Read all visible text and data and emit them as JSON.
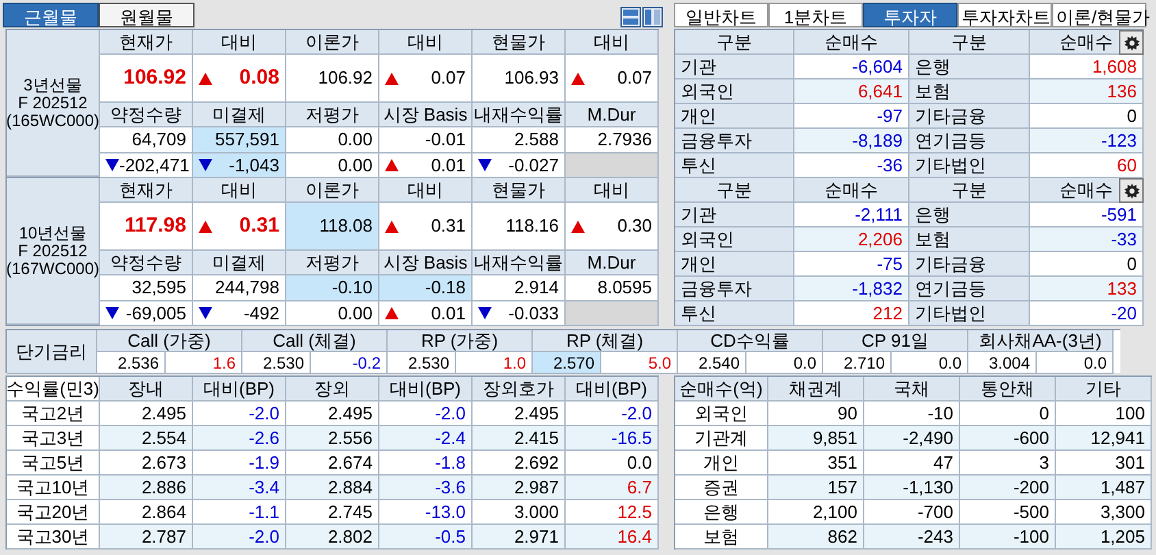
{
  "top_tabs": [
    {
      "label": "근월물",
      "selected": true
    },
    {
      "label": "원월물",
      "selected": false
    }
  ],
  "futures": [
    {
      "label": [
        "3년선물",
        "F 202512",
        "(165WC000)"
      ],
      "head1": [
        "현재가",
        "대비",
        "이론가",
        "대비",
        "현물가",
        "대비"
      ],
      "row1": [
        {
          "text": "106.92",
          "color": "#e00000",
          "highlighted": false
        },
        {
          "text": "0.08",
          "color": "#e00000",
          "kind": "up",
          "highlighted": false
        },
        {
          "text": "106.92",
          "color": "#000000",
          "highlighted": false
        },
        {
          "text": "0.07",
          "color": "#000000",
          "kind": "up",
          "highlighted": false
        },
        {
          "text": "106.93",
          "color": "#000000",
          "highlighted": false
        },
        {
          "text": "0.07",
          "color": "#000000",
          "kind": "up",
          "highlighted": false
        }
      ],
      "head2": [
        "약정수량",
        "미결제",
        "저평가",
        "시장 Basis",
        "내재수익률",
        "M.Dur"
      ],
      "row2": [
        {
          "text": "64,709",
          "color": "#000000",
          "highlighted": false
        },
        {
          "text": "557,591",
          "color": "#000000",
          "highlighted": true
        },
        {
          "text": "0.00",
          "color": "#000000",
          "highlighted": false
        },
        {
          "text": "-0.01",
          "color": "#000000",
          "highlighted": false
        },
        {
          "text": "2.588",
          "color": "#000000",
          "highlighted": false
        },
        {
          "text": "2.7936",
          "color": "#000000",
          "highlighted": false
        }
      ],
      "row3": [
        {
          "text": "-202,471",
          "color": "#000000",
          "kind": "down",
          "highlighted": false
        },
        {
          "text": "-1,043",
          "color": "#000000",
          "kind": "down",
          "highlighted": true
        },
        {
          "text": "0.00",
          "color": "#000000",
          "highlighted": false
        },
        {
          "text": "0.01",
          "color": "#000000",
          "kind": "up",
          "highlighted": false
        },
        {
          "text": "-0.027",
          "color": "#000000",
          "kind": "down",
          "highlighted": false
        }
      ]
    },
    {
      "label": [
        "10년선물",
        "F 202512",
        "(167WC000)"
      ],
      "head1": [
        "현재가",
        "대비",
        "이론가",
        "대비",
        "현물가",
        "대비"
      ],
      "row1": [
        {
          "text": "117.98",
          "color": "#e00000",
          "highlighted": false
        },
        {
          "text": "0.31",
          "color": "#e00000",
          "kind": "up",
          "highlighted": false
        },
        {
          "text": "118.08",
          "color": "#000000",
          "highlighted": true
        },
        {
          "text": "0.31",
          "color": "#000000",
          "kind": "up",
          "highlighted": false
        },
        {
          "text": "118.16",
          "color": "#000000",
          "highlighted": false
        },
        {
          "text": "0.30",
          "color": "#000000",
          "kind": "up",
          "highlighted": false
        }
      ],
      "head2": [
        "약정수량",
        "미결제",
        "저평가",
        "시장 Basis",
        "내재수익률",
        "M.Dur"
      ],
      "row2": [
        {
          "text": "32,595",
          "color": "#000000",
          "highlighted": false
        },
        {
          "text": "244,798",
          "color": "#000000",
          "highlighted": false
        },
        {
          "text": "-0.10",
          "color": "#000000",
          "highlighted": true
        },
        {
          "text": "-0.18",
          "color": "#000000",
          "highlighted": true
        },
        {
          "text": "2.914",
          "color": "#000000",
          "highlighted": false
        },
        {
          "text": "8.0595",
          "color": "#000000",
          "highlighted": false
        }
      ],
      "row3": [
        {
          "text": "-69,005",
          "color": "#000000",
          "kind": "down",
          "highlighted": false
        },
        {
          "text": "-492",
          "color": "#000000",
          "kind": "down",
          "highlighted": false
        },
        {
          "text": "0.00",
          "color": "#000000",
          "highlighted": false
        },
        {
          "text": "0.01",
          "color": "#000000",
          "kind": "up",
          "highlighted": false
        },
        {
          "text": "-0.033",
          "color": "#000000",
          "kind": "down",
          "highlighted": false
        }
      ]
    }
  ],
  "chart_tabs": [
    {
      "label": "일반차트",
      "selected": false
    },
    {
      "label": "1분차트",
      "selected": false
    },
    {
      "label": "투자자",
      "selected": true
    },
    {
      "label": "투자자차트",
      "selected": false
    },
    {
      "label": "이론/현물가",
      "selected": false
    }
  ],
  "investor_tables": [
    {
      "columns": [
        "구분",
        "순매수",
        "구분",
        "순매수"
      ],
      "rows": [
        {
          "cells": [
            {
              "text": "기관"
            },
            {
              "text": "-6,604",
              "color": "#0000d8"
            },
            {
              "text": "은행"
            },
            {
              "text": "1,608",
              "color": "#e00000"
            }
          ]
        },
        {
          "cells": [
            {
              "text": "외국인"
            },
            {
              "text": "6,641",
              "color": "#e00000"
            },
            {
              "text": "보험"
            },
            {
              "text": "136",
              "color": "#e00000"
            }
          ]
        },
        {
          "cells": [
            {
              "text": "개인"
            },
            {
              "text": "-97",
              "color": "#0000d8"
            },
            {
              "text": "기타금융"
            },
            {
              "text": "0",
              "color": "#000000"
            }
          ]
        },
        {
          "cells": [
            {
              "text": "금융투자"
            },
            {
              "text": "-8,189",
              "color": "#0000d8"
            },
            {
              "text": "연기금등"
            },
            {
              "text": "-123",
              "color": "#0000d8"
            }
          ]
        },
        {
          "cells": [
            {
              "text": "투신"
            },
            {
              "text": "-36",
              "color": "#0000d8"
            },
            {
              "text": "기타법인"
            },
            {
              "text": "60",
              "color": "#e00000"
            }
          ]
        }
      ]
    },
    {
      "columns": [
        "구분",
        "순매수",
        "구분",
        "순매수"
      ],
      "rows": [
        {
          "cells": [
            {
              "text": "기관"
            },
            {
              "text": "-2,111",
              "color": "#0000d8"
            },
            {
              "text": "은행"
            },
            {
              "text": "-591",
              "color": "#0000d8"
            }
          ]
        },
        {
          "cells": [
            {
              "text": "외국인"
            },
            {
              "text": "2,206",
              "color": "#e00000"
            },
            {
              "text": "보험"
            },
            {
              "text": "-33",
              "color": "#0000d8"
            }
          ]
        },
        {
          "cells": [
            {
              "text": "개인"
            },
            {
              "text": "-75",
              "color": "#0000d8"
            },
            {
              "text": "기타금융"
            },
            {
              "text": "0",
              "color": "#000000"
            }
          ]
        },
        {
          "cells": [
            {
              "text": "금융투자"
            },
            {
              "text": "-1,832",
              "color": "#0000d8"
            },
            {
              "text": "연기금등"
            },
            {
              "text": "133",
              "color": "#e00000"
            }
          ]
        },
        {
          "cells": [
            {
              "text": "투신"
            },
            {
              "text": "212",
              "color": "#e00000"
            },
            {
              "text": "기타법인"
            },
            {
              "text": "-20",
              "color": "#0000d8"
            }
          ]
        }
      ]
    }
  ],
  "short_rates": {
    "label": "단기금리",
    "items": [
      {
        "name": "Call (가중)",
        "rate": "2.536",
        "change": "1.6",
        "color": "#e00000",
        "highlighted": false
      },
      {
        "name": "Call (체결)",
        "rate": "2.530",
        "change": "-0.2",
        "color": "#0000d8",
        "highlighted": false
      },
      {
        "name": "RP (가중)",
        "rate": "2.530",
        "change": "1.0",
        "color": "#e00000",
        "highlighted": false
      },
      {
        "name": "RP (체결)",
        "rate": "2.570",
        "change": "5.0",
        "color": "#e00000",
        "highlighted": true
      },
      {
        "name": "CD수익률",
        "rate": "2.540",
        "change": "0.0",
        "color": "#000000",
        "highlighted": false
      },
      {
        "name": "CP 91일",
        "rate": "2.710",
        "change": "0.0",
        "color": "#000000",
        "highlighted": false
      },
      {
        "name": "회사채AA-(3년)",
        "rate": "3.004",
        "change": "0.0",
        "color": "#000000",
        "highlighted": false
      }
    ]
  },
  "yield_table": {
    "columns": [
      "수익률(민3)",
      "장내",
      "대비(BP)",
      "장외",
      "대비(BP)",
      "장외호가",
      "대비(BP)"
    ],
    "rows": [
      {
        "cells": [
          {
            "text": "국고2년"
          },
          {
            "text": "2.495"
          },
          {
            "text": "-2.0",
            "color": "#0000d8"
          },
          {
            "text": "2.495"
          },
          {
            "text": "-2.0",
            "color": "#0000d8"
          },
          {
            "text": "2.495"
          },
          {
            "text": "-2.0",
            "color": "#0000d8"
          }
        ]
      },
      {
        "cells": [
          {
            "text": "국고3년"
          },
          {
            "text": "2.554"
          },
          {
            "text": "-2.6",
            "color": "#0000d8"
          },
          {
            "text": "2.556"
          },
          {
            "text": "-2.4",
            "color": "#0000d8"
          },
          {
            "text": "2.415"
          },
          {
            "text": "-16.5",
            "color": "#0000d8"
          }
        ]
      },
      {
        "cells": [
          {
            "text": "국고5년"
          },
          {
            "text": "2.673"
          },
          {
            "text": "-1.9",
            "color": "#0000d8"
          },
          {
            "text": "2.674"
          },
          {
            "text": "-1.8",
            "color": "#0000d8"
          },
          {
            "text": "2.692"
          },
          {
            "text": "0.0",
            "color": "#000000"
          }
        ]
      },
      {
        "cells": [
          {
            "text": "국고10년"
          },
          {
            "text": "2.886"
          },
          {
            "text": "-3.4",
            "color": "#0000d8"
          },
          {
            "text": "2.884"
          },
          {
            "text": "-3.6",
            "color": "#0000d8"
          },
          {
            "text": "2.987"
          },
          {
            "text": "6.7",
            "color": "#e00000"
          }
        ]
      },
      {
        "cells": [
          {
            "text": "국고20년"
          },
          {
            "text": "2.864"
          },
          {
            "text": "-1.1",
            "color": "#0000d8"
          },
          {
            "text": "2.745"
          },
          {
            "text": "-13.0",
            "color": "#0000d8"
          },
          {
            "text": "3.000"
          },
          {
            "text": "12.5",
            "color": "#e00000"
          }
        ]
      },
      {
        "cells": [
          {
            "text": "국고30년"
          },
          {
            "text": "2.787"
          },
          {
            "text": "-2.0",
            "color": "#0000d8"
          },
          {
            "text": "2.802"
          },
          {
            "text": "-0.5",
            "color": "#0000d8"
          },
          {
            "text": "2.971"
          },
          {
            "text": "16.4",
            "color": "#e00000"
          }
        ]
      }
    ]
  },
  "bond_flow_table": {
    "columns": [
      "순매수(억)",
      "채권계",
      "국채",
      "통안채",
      "기타"
    ],
    "rows": [
      {
        "cells": [
          "외국인",
          "90",
          "-10",
          "0",
          "100"
        ]
      },
      {
        "cells": [
          "기관계",
          "9,851",
          "-2,490",
          "-600",
          "12,941"
        ]
      },
      {
        "cells": [
          "개인",
          "351",
          "47",
          "3",
          "301"
        ]
      },
      {
        "cells": [
          "증권",
          "157",
          "-1,130",
          "-200",
          "1,487"
        ]
      },
      {
        "cells": [
          "은행",
          "2,100",
          "-700",
          "-500",
          "3,300"
        ]
      },
      {
        "cells": [
          "보험",
          "862",
          "-243",
          "-100",
          "1,205"
        ]
      }
    ]
  }
}
